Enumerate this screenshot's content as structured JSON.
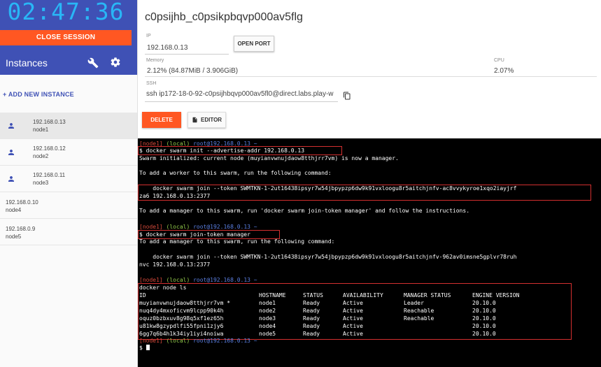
{
  "sidebar": {
    "timer": "02:47:36",
    "close_session": "CLOSE SESSION",
    "instances_title": "Instances",
    "add_instance": "+ ADD NEW INSTANCE",
    "instances": [
      {
        "ip": "192.168.0.13",
        "name": "node1",
        "selected": true,
        "icon": "user-icon"
      },
      {
        "ip": "192.168.0.12",
        "name": "node2",
        "selected": false,
        "icon": "user-icon"
      },
      {
        "ip": "192.168.0.11",
        "name": "node3",
        "selected": false,
        "icon": "user-icon"
      },
      {
        "ip": "192.168.0.10",
        "name": "node4",
        "selected": false
      },
      {
        "ip": "192.168.0.9",
        "name": "node5",
        "selected": false
      }
    ]
  },
  "main": {
    "instance_name": "c0psijhb_c0psikpbqvp000av5flg",
    "ip_label": "IP",
    "ip_value": "192.168.0.13",
    "open_port": "OPEN PORT",
    "memory_label": "Memory",
    "memory_value": "2.12% (84.87MiB / 3.906GiB)",
    "cpu_label": "CPU",
    "cpu_value": "2.07%",
    "ssh_label": "SSH",
    "ssh_value": "ssh ip172-18-0-92-c0psijhbqvp000av5fl0@direct.labs.play-w",
    "delete": "DELETE",
    "editor": "EDITOR"
  },
  "terminal": {
    "prompt1_host": "[node1]",
    "prompt1_local": "(local)",
    "prompt1_user": "root@192.168.0.13 ~",
    "cmd1": "$ docker swarm init --advertise-addr 192.168.0.13",
    "out1": "Swarm initialized: current node (muyianvwnujdaow8tthjrr7vm) is now a manager.",
    "out2": "To add a worker to this swarm, run the following command:",
    "join_worker_1": "    docker swarm join --token SWMTKN-1-2ut16438ipsyr7w54jbpypzp6dw9k91vxloogu8r5aitchjnfv-ac8vvykyroe1xqo2iayjrf",
    "join_worker_2": "za6 192.168.0.13:2377",
    "out3": "To add a manager to this swarm, run 'docker swarm join-token manager' and follow the instructions.",
    "prompt2_host": "[node1]",
    "prompt2_local": "(local)",
    "prompt2_user": "root@192.168.0.13 ~",
    "cmd2": "$ docker swarm join-token manager",
    "out4": "To add a manager to this swarm, run the following command:",
    "join_mgr_1": "    docker swarm join --token SWMTKN-1-2ut16438ipsyr7w54jbpypzp6dw9k91vxloogu8r5aitchjnfv-962av0imsne5gplvr78ruh",
    "join_mgr_2": "nvc 192.168.0.13:2377",
    "prompt3_host": "[node1]",
    "prompt3_local": "(local)",
    "prompt3_user": "root@192.168.0.13 ~",
    "cmd3": "docker node ls",
    "table_headers": [
      "ID",
      "HOSTNAME",
      "STATUS",
      "AVAILABILITY",
      "MANAGER STATUS",
      "ENGINE VERSION"
    ],
    "table_rows": [
      [
        "muyianvwnujdaow8tthjrr7vm *",
        "node1",
        "Ready",
        "Active",
        "Leader",
        "20.10.0"
      ],
      [
        "nuq4dy4mxoficvm9lcpp90k4h",
        "node2",
        "Ready",
        "Active",
        "Reachable",
        "20.10.0"
      ],
      [
        "oquz0bzbxuv8g98q5xf1ez65h",
        "node3",
        "Ready",
        "Active",
        "Reachable",
        "20.10.0"
      ],
      [
        "u81kw8gzypdlfi55fpni1zjy6",
        "node4",
        "Ready",
        "Active",
        "",
        "20.10.0"
      ],
      [
        "6gg7q6b4h1k34iy1iyi4noiwa",
        "node5",
        "Ready",
        "Active",
        "",
        "20.10.0"
      ]
    ],
    "prompt4_host": "[node1]",
    "prompt4_local": "(local)",
    "prompt4_user": "root@192.168.0.13 ~",
    "prompt_symbol": "$"
  }
}
